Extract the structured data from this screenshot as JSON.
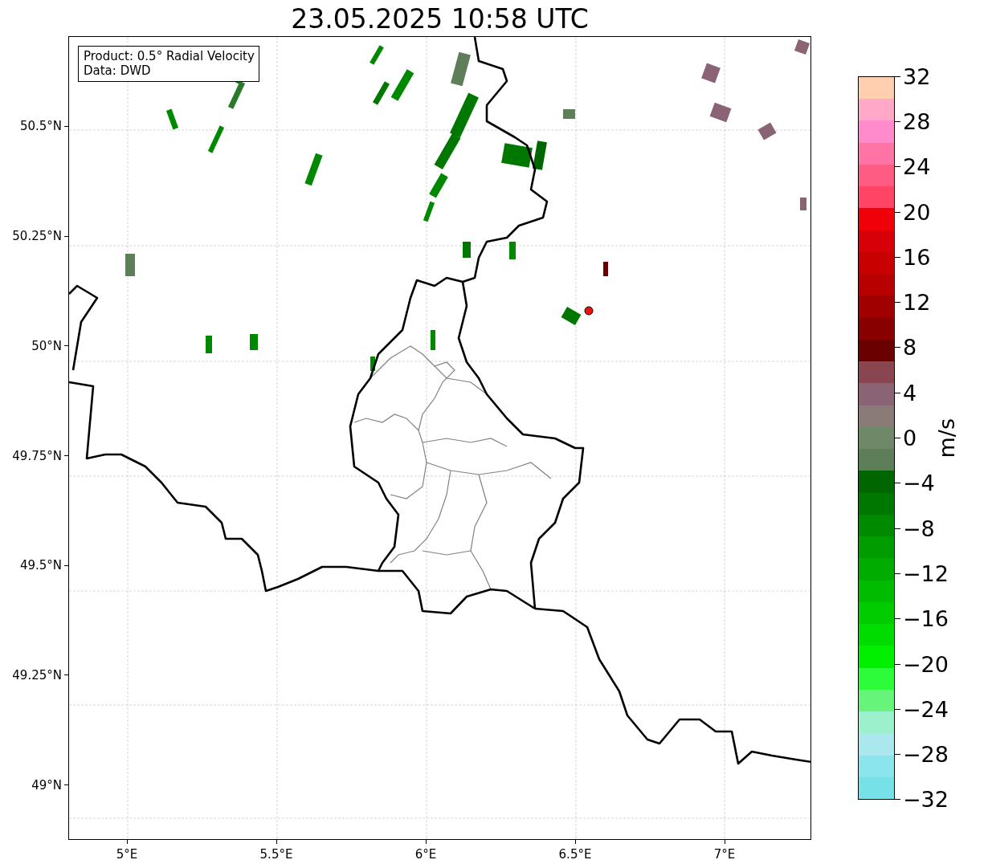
{
  "title": "23.05.2025 10:58 UTC",
  "legend": [
    "Product: 0.5° Radial Velocity",
    "Data: DWD"
  ],
  "y_ticks": [
    "50.5°N",
    "50.25°N",
    "50°N",
    "49.75°N",
    "49.5°N",
    "49.25°N",
    "49°N"
  ],
  "x_ticks": [
    "5°E",
    "5.5°E",
    "6°E",
    "6.5°E",
    "7°E"
  ],
  "colorbar": {
    "label": "m/s",
    "ticks": [
      "32",
      "28",
      "24",
      "20",
      "16",
      "12",
      "8",
      "4",
      "0",
      "−4",
      "−8",
      "−12",
      "−16",
      "−20",
      "−24",
      "−28",
      "−32"
    ],
    "bands": [
      {
        "color": "#76e2e8"
      },
      {
        "color": "#8ae6ec"
      },
      {
        "color": "#aae8ee"
      },
      {
        "color": "#9cf0cc"
      },
      {
        "color": "#66f47a"
      },
      {
        "color": "#2cfc3a"
      },
      {
        "color": "#00f000"
      },
      {
        "color": "#00dc00"
      },
      {
        "color": "#00cc00"
      },
      {
        "color": "#00bc00"
      },
      {
        "color": "#00ac00"
      },
      {
        "color": "#009c00"
      },
      {
        "color": "#008a00"
      },
      {
        "color": "#007800"
      },
      {
        "color": "#006600"
      },
      {
        "color": "#5e7e5a"
      },
      {
        "color": "#6e8868"
      },
      {
        "color": "#8a7a78"
      },
      {
        "color": "#8a6474"
      },
      {
        "color": "#8a4650"
      },
      {
        "color": "#6a0000"
      },
      {
        "color": "#880000"
      },
      {
        "color": "#a00000"
      },
      {
        "color": "#b80000"
      },
      {
        "color": "#c80000"
      },
      {
        "color": "#d80008"
      },
      {
        "color": "#f00008"
      },
      {
        "color": "#ff4466"
      },
      {
        "color": "#ff5c84"
      },
      {
        "color": "#ff74a4"
      },
      {
        "color": "#ff8acc"
      },
      {
        "color": "#ffa8c8"
      },
      {
        "color": "#ffcfb0"
      }
    ]
  }
}
